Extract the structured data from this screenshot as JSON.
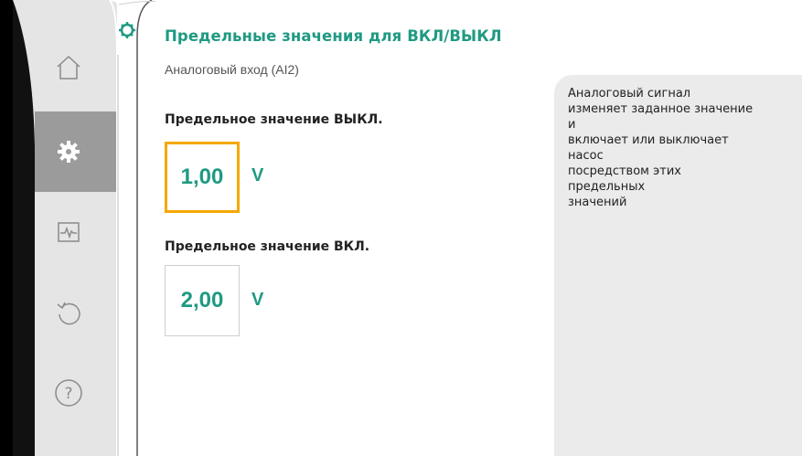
{
  "title": "Предельные значения для ВКЛ/ВЫКЛ",
  "subtitle": "Аналоговый вход (AI2)",
  "fields": [
    {
      "label": "Предельное значение ВЫКЛ.",
      "value": "1,00",
      "unit": "V",
      "selected": true
    },
    {
      "label": "Предельное значение ВКЛ.",
      "value": "2,00",
      "unit": "V",
      "selected": false
    }
  ],
  "help_text": "Аналоговый сигнал\nизменяет заданное значение\nи\nвключает или выключает\nнасос\nпосредством этих\nпредельных\nзначений",
  "nav": [
    "home-icon",
    "gear-icon",
    "diagnostics-icon",
    "undo-icon",
    "help-icon"
  ],
  "colors": {
    "accent": "#1f9a82",
    "selection": "#f5a800",
    "rail": "#e4e4e4",
    "rail_active": "#9b9b9b",
    "help_bg": "#ebebeb"
  }
}
